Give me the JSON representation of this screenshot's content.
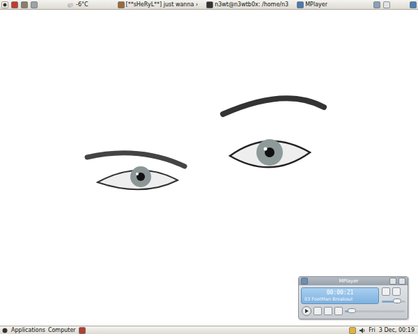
{
  "top_panel": {
    "weather": "-6°C",
    "tasks": [
      {
        "label": "[**sHeRyL**] just wanna ›",
        "selected": false
      },
      {
        "label": "n3wt@n3wtb0x: /home/n3",
        "selected": false
      },
      {
        "label": "MPlayer",
        "selected": false
      }
    ]
  },
  "bottom_panel": {
    "menus": [
      "Applications",
      "Computer"
    ],
    "clock": "Fri  3 Dec, 00:19"
  },
  "mplayer": {
    "title": "MPlayer",
    "time": "00:00:21",
    "track": "03 FootMan Breakout",
    "position": {
      "level": 0.12
    },
    "volume": {
      "level": 0.65
    }
  }
}
